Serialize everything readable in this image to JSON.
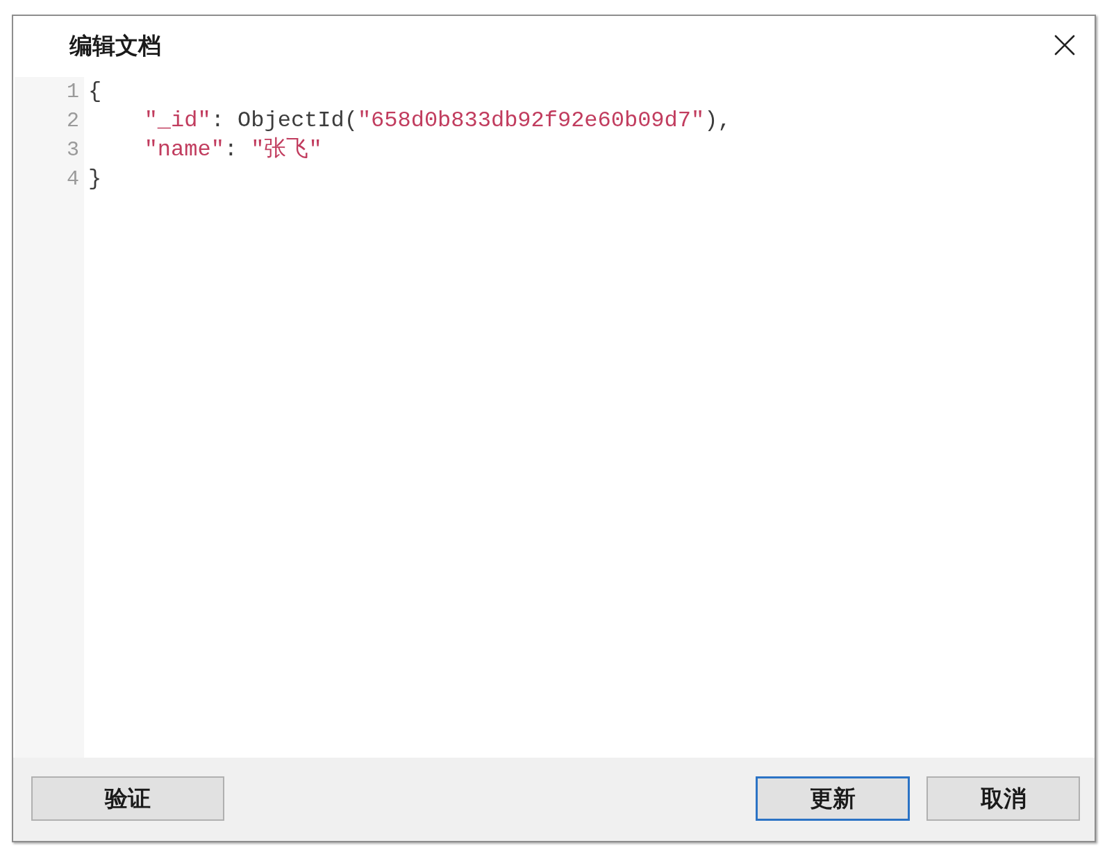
{
  "dialog": {
    "title": "编辑文档"
  },
  "editor": {
    "lines": [
      {
        "number": "1",
        "tokens": [
          {
            "kind": "plain",
            "text": "{"
          }
        ],
        "children": [
          {
            "number": "2",
            "tokens": [
              {
                "kind": "key",
                "text": "\"_id\""
              },
              {
                "kind": "plain",
                "text": ": ObjectId("
              },
              {
                "kind": "string",
                "text": "\"658d0b833db92f92e60b09d7\""
              },
              {
                "kind": "plain",
                "text": "),"
              }
            ]
          },
          {
            "number": "3",
            "tokens": [
              {
                "kind": "key",
                "text": "\"name\""
              },
              {
                "kind": "plain",
                "text": ": "
              },
              {
                "kind": "string",
                "text": "\"张飞\""
              }
            ]
          }
        ]
      },
      {
        "number": "4",
        "tokens": [
          {
            "kind": "plain",
            "text": "}"
          }
        ]
      }
    ]
  },
  "footer": {
    "left_buttons": [
      {
        "label": "验证",
        "focused": false
      }
    ],
    "right_buttons": [
      {
        "label": "更新",
        "focused": true
      },
      {
        "label": "取消",
        "focused": false
      }
    ]
  }
}
